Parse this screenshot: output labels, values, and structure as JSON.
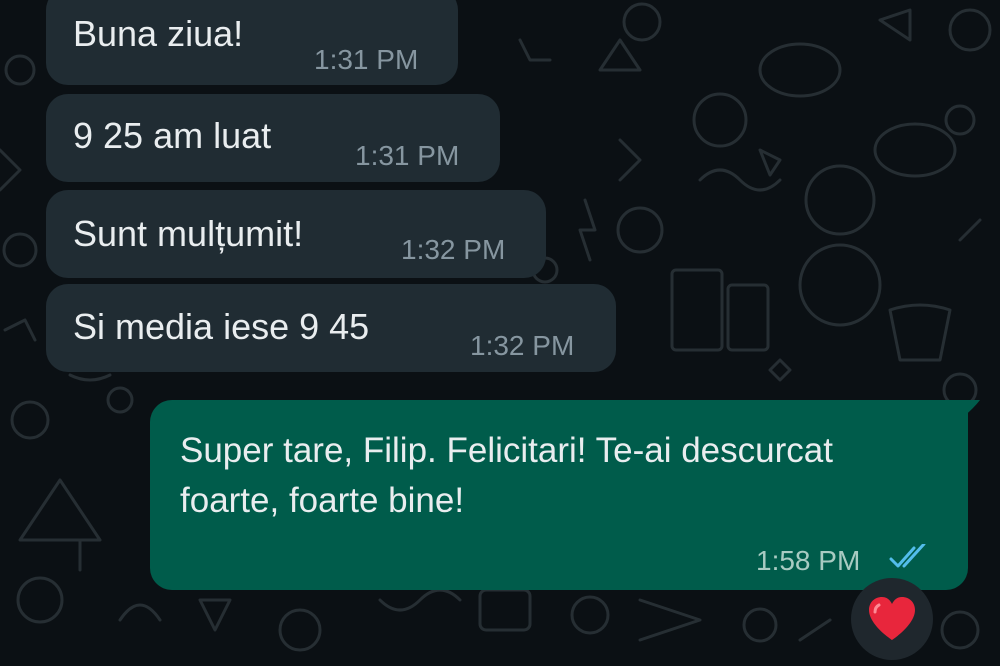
{
  "messages": [
    {
      "direction": "incoming",
      "text": "Buna ziua!",
      "time": "1:31 PM"
    },
    {
      "direction": "incoming",
      "text": "9 25 am luat",
      "time": "1:31 PM"
    },
    {
      "direction": "incoming",
      "text": "Sunt mulțumit!",
      "time": "1:32 PM"
    },
    {
      "direction": "incoming",
      "text": "Si media iese 9 45",
      "time": "1:32 PM"
    },
    {
      "direction": "outgoing",
      "text": "Super tare, Filip. Felicitari! Te-ai descurcat foarte, foarte bine!",
      "time": "1:58 PM",
      "status_icon": "double-check-read-icon",
      "reaction": "red-heart"
    }
  ],
  "colors": {
    "background": "#0b1014",
    "incoming_bubble": "#202c33",
    "outgoing_bubble": "#005c4b",
    "read_ticks": "#53bdeb",
    "heart": "#e8263c"
  }
}
